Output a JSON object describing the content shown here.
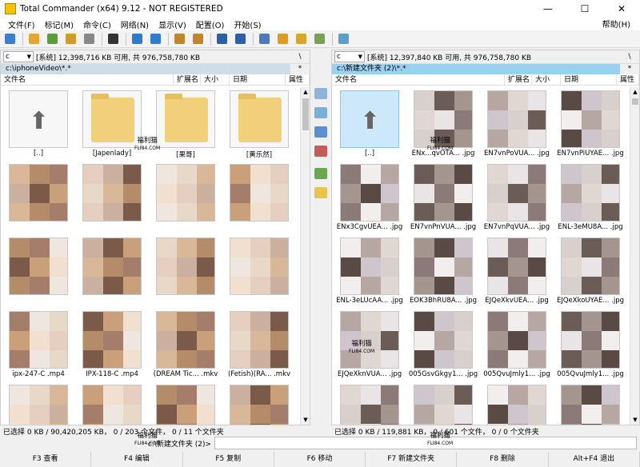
{
  "title": "Total Commander (x64) 9.12 - NOT REGISTERED",
  "menu": [
    "文件(F)",
    "标记(M)",
    "命令(C)",
    "网络(N)",
    "显示(V)",
    "配置(O)",
    "开始(S)"
  ],
  "help": "帮助(H)",
  "window_buttons": {
    "minimize": "—",
    "maximize": "☐",
    "close": "✕"
  },
  "toolbar_icons": [
    "refresh-icon",
    "view-brief-icon",
    "view-thumbs-icon",
    "tree-icon",
    "compare-icon",
    "invert-icon",
    "back-icon",
    "forward-icon",
    "pack-icon",
    "unpack-icon",
    "ftp-icon",
    "url-icon",
    "search-icon",
    "sync-icon",
    "multirename-icon",
    "editor-icon",
    "copy-names-icon"
  ],
  "left": {
    "drive": "c",
    "drive_info": "[系统]  12,398,716 KB 可用,  共 976,758,780 KB",
    "nav_root": "\\",
    "nav_up": "..",
    "path": "c:\\iphoneVideo\\*.*",
    "hist": "*",
    "cols": [
      "文件名",
      "扩展名",
      "大小",
      "日期",
      "属性"
    ],
    "items": [
      {
        "caption": "[..]",
        "kind": "up"
      },
      {
        "caption": "[Japenlady]",
        "kind": "folder"
      },
      {
        "caption": "[果哥]",
        "kind": "folder"
      },
      {
        "caption": "[黄乐然]",
        "kind": "folder"
      },
      {
        "caption": "",
        "kind": "blur"
      },
      {
        "caption": "",
        "kind": "blur"
      },
      {
        "caption": "",
        "kind": "blur"
      },
      {
        "caption": "",
        "kind": "blur"
      },
      {
        "caption": "",
        "kind": "blur"
      },
      {
        "caption": "",
        "kind": "blur"
      },
      {
        "caption": "",
        "kind": "blur"
      },
      {
        "caption": "",
        "kind": "blur"
      },
      {
        "caption": "ipx-247-C  .mp4",
        "kind": "blur"
      },
      {
        "caption": "IPX-118-C  .mp4",
        "kind": "blur"
      },
      {
        "caption": "(DREAM Tic... .mkv",
        "kind": "blur"
      },
      {
        "caption": "(Fetish)(RA... .mkv",
        "kind": "blur"
      },
      {
        "caption": "",
        "kind": "blur"
      },
      {
        "caption": "",
        "kind": "blur"
      },
      {
        "caption": "",
        "kind": "blur"
      },
      {
        "caption": "",
        "kind": "blur"
      }
    ],
    "status": "已选择 0 KB / 90,420,205 KB，  0 / 203 个文件，  0 / 11 个文件夹"
  },
  "right": {
    "drive": "c",
    "drive_info": "[系统]  12,397,840 KB 可用,  共 976,758,780 KB",
    "nav_root": "\\",
    "nav_up": "..",
    "path": "c:\\新建文件夹 (2)\\*.*",
    "hist": "*",
    "cols": [
      "文件名",
      "扩展名",
      "大小",
      "日期",
      "属性"
    ],
    "items": [
      {
        "caption": "[..]",
        "kind": "up"
      },
      {
        "caption": "ENx...qvOTA... .jpg",
        "kind": "photo"
      },
      {
        "caption": "EN7vnPoVUA... .jpg",
        "kind": "photo"
      },
      {
        "caption": "EN7vnPiUYAE... .jpg",
        "kind": "photo"
      },
      {
        "caption": "ENx3CgvUEA... .jpg",
        "kind": "photo"
      },
      {
        "caption": "EN7vnPnVUA... .jpg",
        "kind": "photo"
      },
      {
        "caption": "EN7vnPqVUA... .jpg",
        "kind": "photo"
      },
      {
        "caption": "ENL-3eMU8A... .jpg",
        "kind": "photo"
      },
      {
        "caption": "ENL-3eLUcAA... .jpg",
        "kind": "photo"
      },
      {
        "caption": "EOK3BhRU8A... .jpg",
        "kind": "photo"
      },
      {
        "caption": "EJQeXkvUEA... .jpg",
        "kind": "photo"
      },
      {
        "caption": "EJQeXkoUYAE... .jpg",
        "kind": "photo"
      },
      {
        "caption": "EJQeXknVUA... .jpg",
        "kind": "photo"
      },
      {
        "caption": "005GsvGkgy1... .jpg",
        "kind": "photo"
      },
      {
        "caption": "005QvuJmly1... .jpg",
        "kind": "photo"
      },
      {
        "caption": "005QvuJmly1... .jpg",
        "kind": "photo"
      },
      {
        "caption": "",
        "kind": "photo"
      },
      {
        "caption": "",
        "kind": "photo"
      },
      {
        "caption": "",
        "kind": "photo"
      },
      {
        "caption": "",
        "kind": "photo"
      }
    ],
    "status": "已选择 0 KB / 119,881 KB，  0 / 601 个文件，  0 / 0 个文件夹"
  },
  "command_label": "c:\\新建文件夹 (2)>",
  "fkeys": [
    "F3 查看",
    "F4 编辑",
    "F5 复制",
    "F6 移动",
    "F7 新建文件夹",
    "F8 删除",
    "Alt+F4 退出"
  ],
  "watermark": {
    "text": "福利猫",
    "sub": "FLI84.COM"
  },
  "colors": {
    "active_path": "#9bd0ef",
    "inactive_path": "#cfdde8",
    "selection": "#cde8fb"
  }
}
